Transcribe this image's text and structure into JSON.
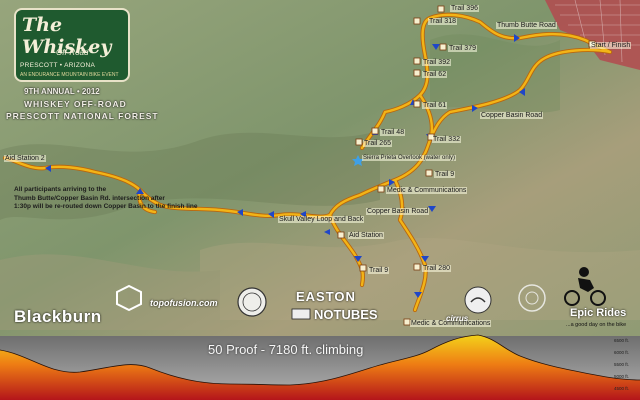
{
  "logo": {
    "title": "The Whiskey",
    "sub": "Off-Road",
    "location": "PRESCOTT • ARIZONA",
    "tagline": "AN ENDURANCE MOUNTAIN BIKE EVENT"
  },
  "event": {
    "line1": "9TH ANNUAL • 2012",
    "line2": "WHISKEY OFF-ROAD",
    "line3": "PRESCOTT NATIONAL FOREST"
  },
  "labels": {
    "thumb_butte_road": "Thumb Butte Road",
    "start_finish": "Start / Finish",
    "trail_318": "Trail 318",
    "trail_396": "Trail 396",
    "trail_379": "Trail 379",
    "trail_392": "Trail 392",
    "trail_62": "Trail 62",
    "trail_61": "Trail 61",
    "trail_48": "Trail 48",
    "trail_265": "Trail 265",
    "trail_332": "Trail 332",
    "copper_basin_road_1": "Copper Basin Road",
    "copper_basin_road_2": "Copper Basin Road",
    "sierra_prieta": "Sierra Prieta Overlook (water only)",
    "medic_1": "Medic & Communications",
    "medic_2": "Medic & Communications",
    "aid_station": "Aid Station",
    "aid_station_2": "Aid Station 2",
    "skull_valley": "Skull Valley Loop and Back",
    "trail_9": "Trail 9",
    "trail_280": "Trail 280",
    "trail_9_2": "Trail 9"
  },
  "note": {
    "line1": "All participants arriving to the",
    "line2": "Thumb Butte/Copper Basin Rd. intersection after",
    "line3": "1:30p will be re-routed down Copper Basin to the finish line"
  },
  "sponsors": {
    "blackburn": "Blackburn",
    "topofusion": "topofusion.com",
    "easton": "EASTON",
    "notubes": "NOTUBES",
    "cirrus": "cirrus",
    "epic": "Epic Rides",
    "epic_tag": "...a good day on the bike"
  },
  "profile": {
    "title": "50 Proof - 7180 ft. climbing",
    "elevations": [
      "6500 ft.",
      "6000 ft.",
      "5500 ft.",
      "5000 ft.",
      "4500 ft."
    ]
  },
  "colors": {
    "route": "#f2b417",
    "route_outline": "#b9660d",
    "arrow": "#1f46c8",
    "town": "#b34a4f",
    "map_green": "#8fa07a",
    "profile_sky": "#8a8a8a"
  }
}
